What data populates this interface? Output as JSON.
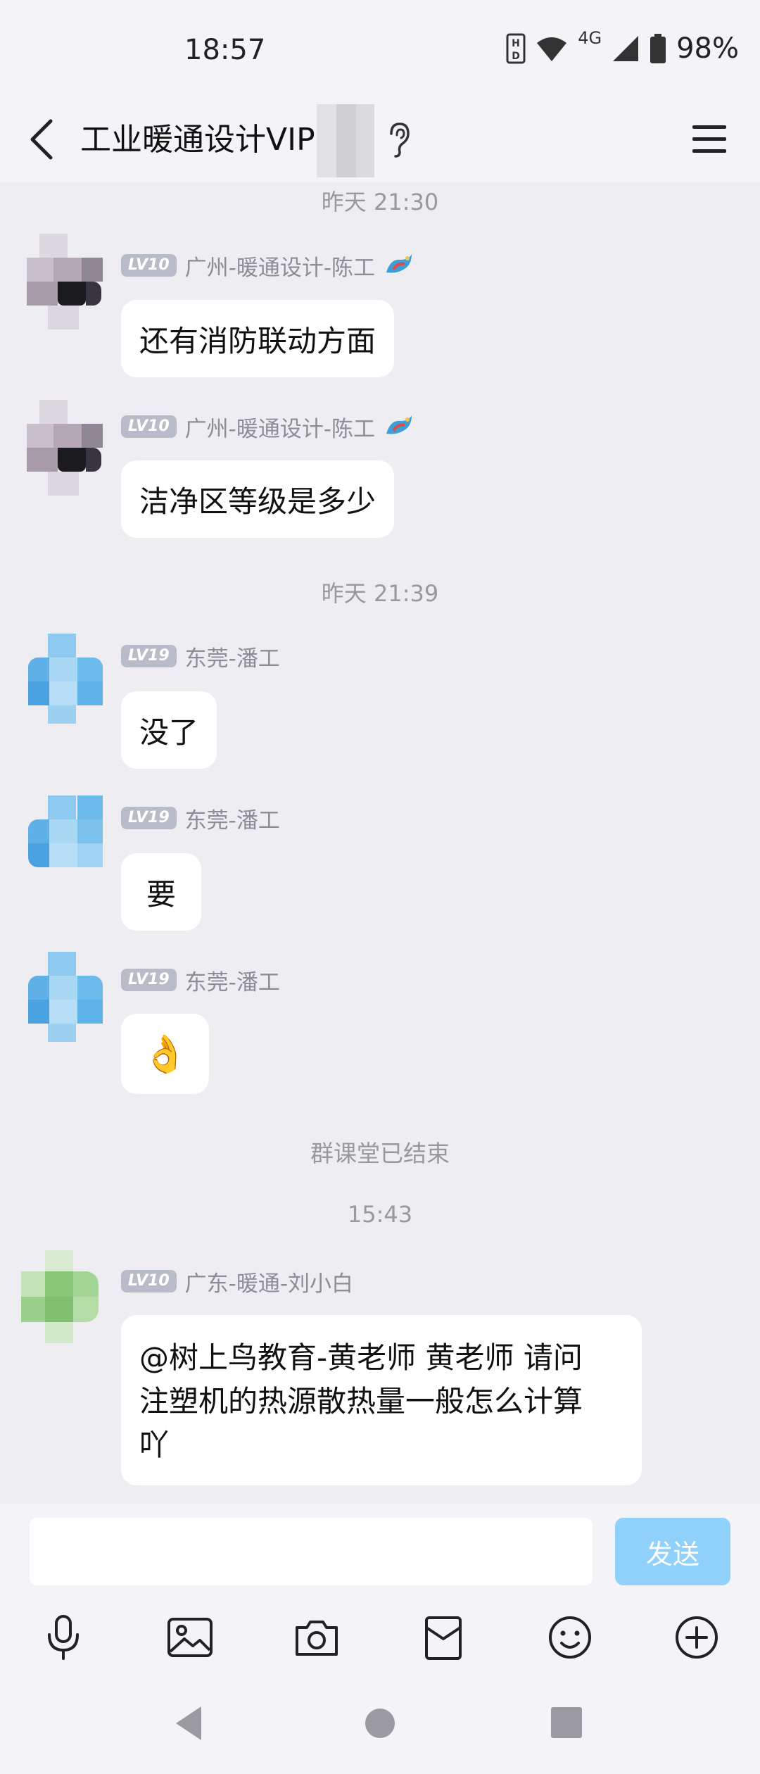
{
  "status_bar": {
    "time": "18:57",
    "network": "4G",
    "battery": "98%"
  },
  "header": {
    "title": "工业暖通设计VIP"
  },
  "messages": {
    "ts1": "昨天 21:30",
    "m1": {
      "level": "LV10",
      "name": "广州-暖通设计-陈工",
      "text": "还有消防联动方面"
    },
    "m2": {
      "level": "LV10",
      "name": "广州-暖通设计-陈工",
      "text": "洁净区等级是多少"
    },
    "ts2": "昨天 21:39",
    "m3": {
      "level": "LV19",
      "name": "东莞-潘工",
      "text": "没了"
    },
    "m4": {
      "level": "LV19",
      "name": "东莞-潘工",
      "text": "要"
    },
    "m5": {
      "level": "LV19",
      "name": "东莞-潘工",
      "text": "👌"
    },
    "system_note": "群课堂已结束",
    "ts3": "15:43",
    "m6": {
      "level": "LV10",
      "name": "广东-暖通-刘小白",
      "line1": "@树上鸟教育-黄老师 黄老师 请问",
      "line2": "注塑机的热源散热量一般怎么计算",
      "line3": "吖"
    }
  },
  "composer": {
    "input_value": "",
    "send_label": "发送"
  },
  "toolbar": [
    "microphone-icon",
    "image-icon",
    "camera-icon",
    "red-packet-icon",
    "emoji-icon",
    "plus-icon"
  ],
  "colors": {
    "background": "#EDEDF2",
    "send_button": "#8FD1FA",
    "level_badge": "#B8BBC8"
  }
}
